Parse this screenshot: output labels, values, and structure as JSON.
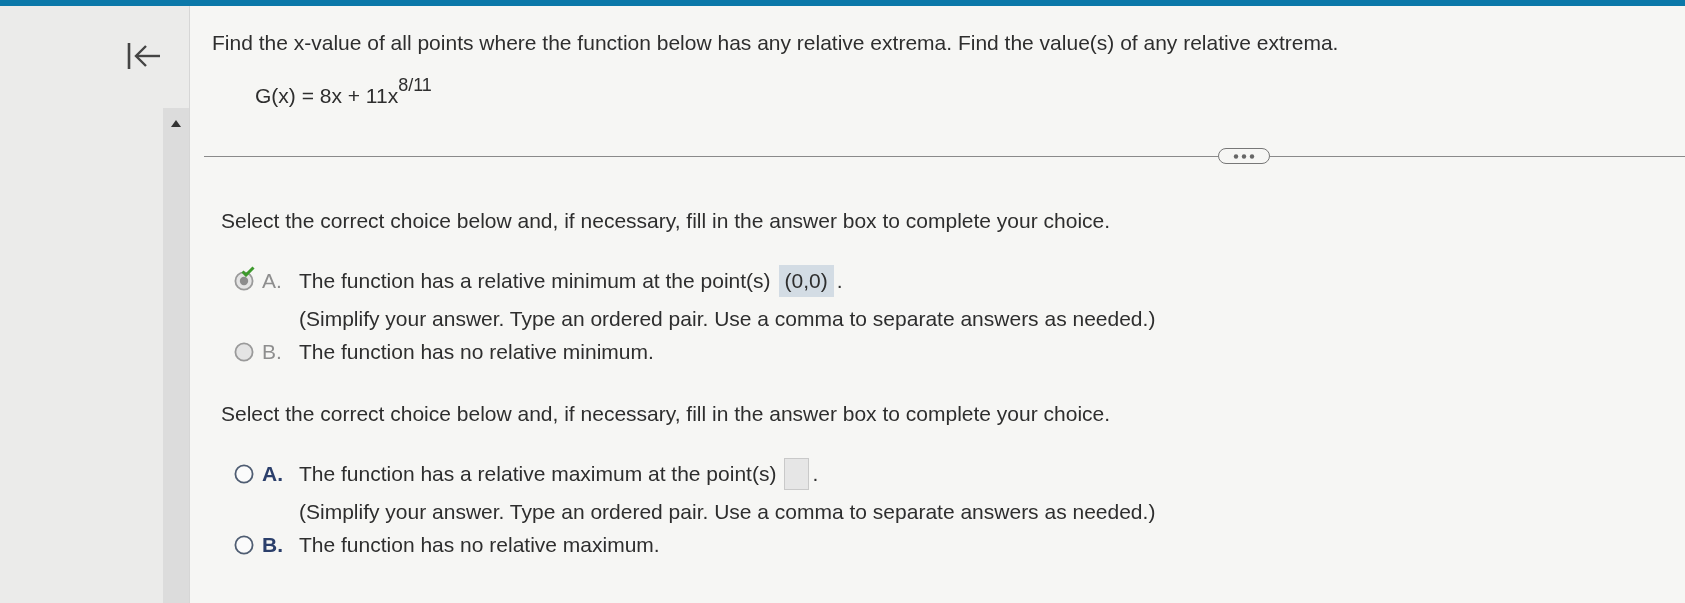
{
  "question": {
    "prompt": "Find the x-value of all points where the function below has any relative extrema. Find the value(s) of any relative extrema.",
    "function": "G(x) = 8x + 11x$^{8/11}$"
  },
  "parts": [
    {
      "instruction": "Select the correct choice below and, if necessary, fill in the answer box to complete your choice.",
      "locked": true,
      "choices": [
        {
          "kind": "fill_in",
          "letter": "A.",
          "text": "The function has a relative minimum at the point(s)",
          "answer": "(0,0)",
          "after": ".",
          "hint": "(Simplify your answer. Type an ordered pair. Use a comma to separate answers as needed.)",
          "selected": true,
          "correct": true
        },
        {
          "kind": "plain",
          "letter": "B.",
          "text": "The function has no relative minimum.",
          "selected": false,
          "correct": false
        }
      ]
    },
    {
      "instruction": "Select the correct choice below and, if necessary, fill in the answer box to complete your choice.",
      "locked": false,
      "choices": [
        {
          "kind": "fill_in",
          "letter": "A.",
          "text": "The function has a relative maximum at the point(s)",
          "after": ".",
          "hint": "(Simplify your answer. Type an ordered pair. Use a comma to separate answers as needed.)",
          "selected": false,
          "correct": false
        },
        {
          "kind": "plain",
          "letter": "B.",
          "text": "The function has no relative maximum.",
          "selected": false,
          "correct": false
        }
      ]
    }
  ]
}
